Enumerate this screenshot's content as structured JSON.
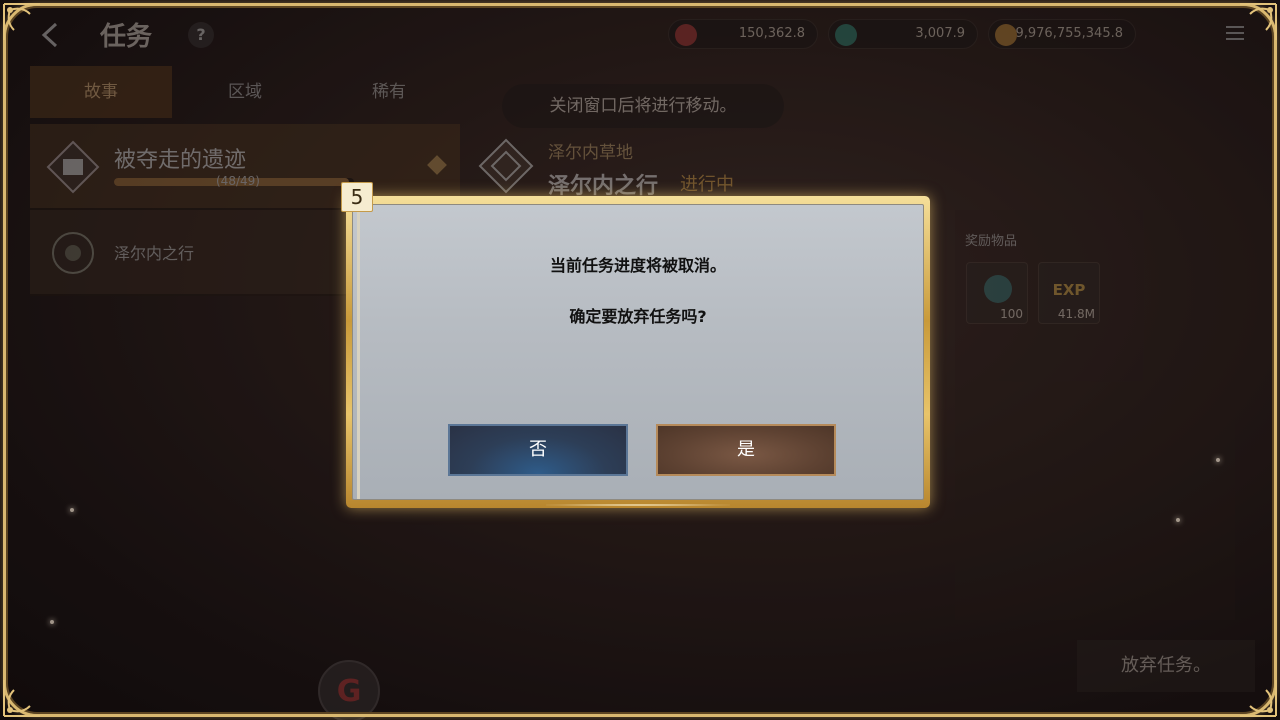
{
  "header": {
    "back_icon": "chevron-left-icon",
    "title": "任务",
    "help_label": "?"
  },
  "currencies": [
    {
      "icon": "red-gem-icon",
      "color": "#b33a3a",
      "value": "150,362.8"
    },
    {
      "icon": "teal-gem-icon",
      "color": "#2e8a7a",
      "value": "3,007.9"
    },
    {
      "icon": "gold-coin-icon",
      "color": "#c48a3a",
      "value": "9,976,755,345.8"
    }
  ],
  "tabs": [
    {
      "label": "故事",
      "active": true
    },
    {
      "label": "区域",
      "active": false
    },
    {
      "label": "稀有",
      "active": false
    }
  ],
  "quests": [
    {
      "title": "被夺走的遗迹",
      "progress_text": "(48/49)",
      "progress": 0.98,
      "selected": true
    },
    {
      "title": "泽尔内之行",
      "selected": false
    }
  ],
  "toast": "关闭窗口后将进行移动。",
  "detail": {
    "subtitle": "泽尔内草地",
    "title": "泽尔内之行",
    "status": "进行中"
  },
  "rewards": {
    "label": "奖励物品",
    "items": [
      {
        "icon": "gem-reward-icon",
        "amount": "100"
      },
      {
        "icon": "exp-icon",
        "label": "EXP",
        "amount": "41.8M"
      }
    ]
  },
  "abandon_button": "放弃任务。",
  "logo_letter": "G",
  "modal": {
    "step": "5",
    "line1": "当前任务进度将被取消。",
    "line2": "确定要放弃任务吗?",
    "no_label": "否",
    "yes_label": "是"
  }
}
